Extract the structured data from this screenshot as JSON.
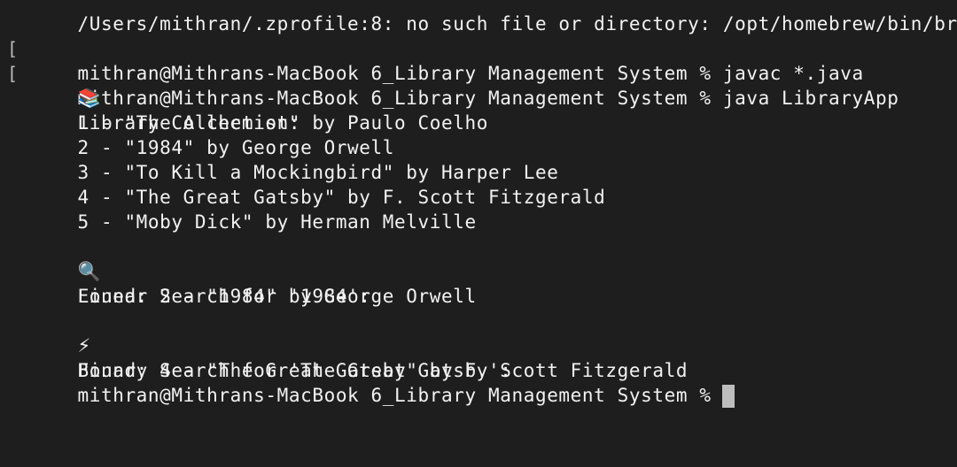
{
  "terminal": {
    "lines": [
      "/Users/mithran/.zprofile:8: no such file or directory: /opt/homebrew/bin/brew",
      "mithran@Mithrans-MacBook 6_Library Management System % javac *.java",
      "mithran@Mithrans-MacBook 6_Library Management System % java LibraryApp",
      "Library Collection:",
      "1 - \"The Alchemist\" by Paulo Coelho",
      "2 - \"1984\" by George Orwell",
      "3 - \"To Kill a Mockingbird\" by Harper Lee",
      "4 - \"The Great Gatsby\" by F. Scott Fitzgerald",
      "5 - \"Moby Dick\" by Herman Melville",
      "",
      "Linear Search for '1984':",
      "Found: 2 - \"1984\" by George Orwell",
      "",
      "Binary Search for 'The Great Gatsby':",
      "Found: 4 - \"The Great Gatsby\" by F. Scott Fitzgerald",
      "mithran@Mithrans-MacBook 6_Library Management System %"
    ],
    "icons": {
      "books": "📚",
      "magnifier": "🔍",
      "lightning": "⚡"
    },
    "bracket": "["
  }
}
